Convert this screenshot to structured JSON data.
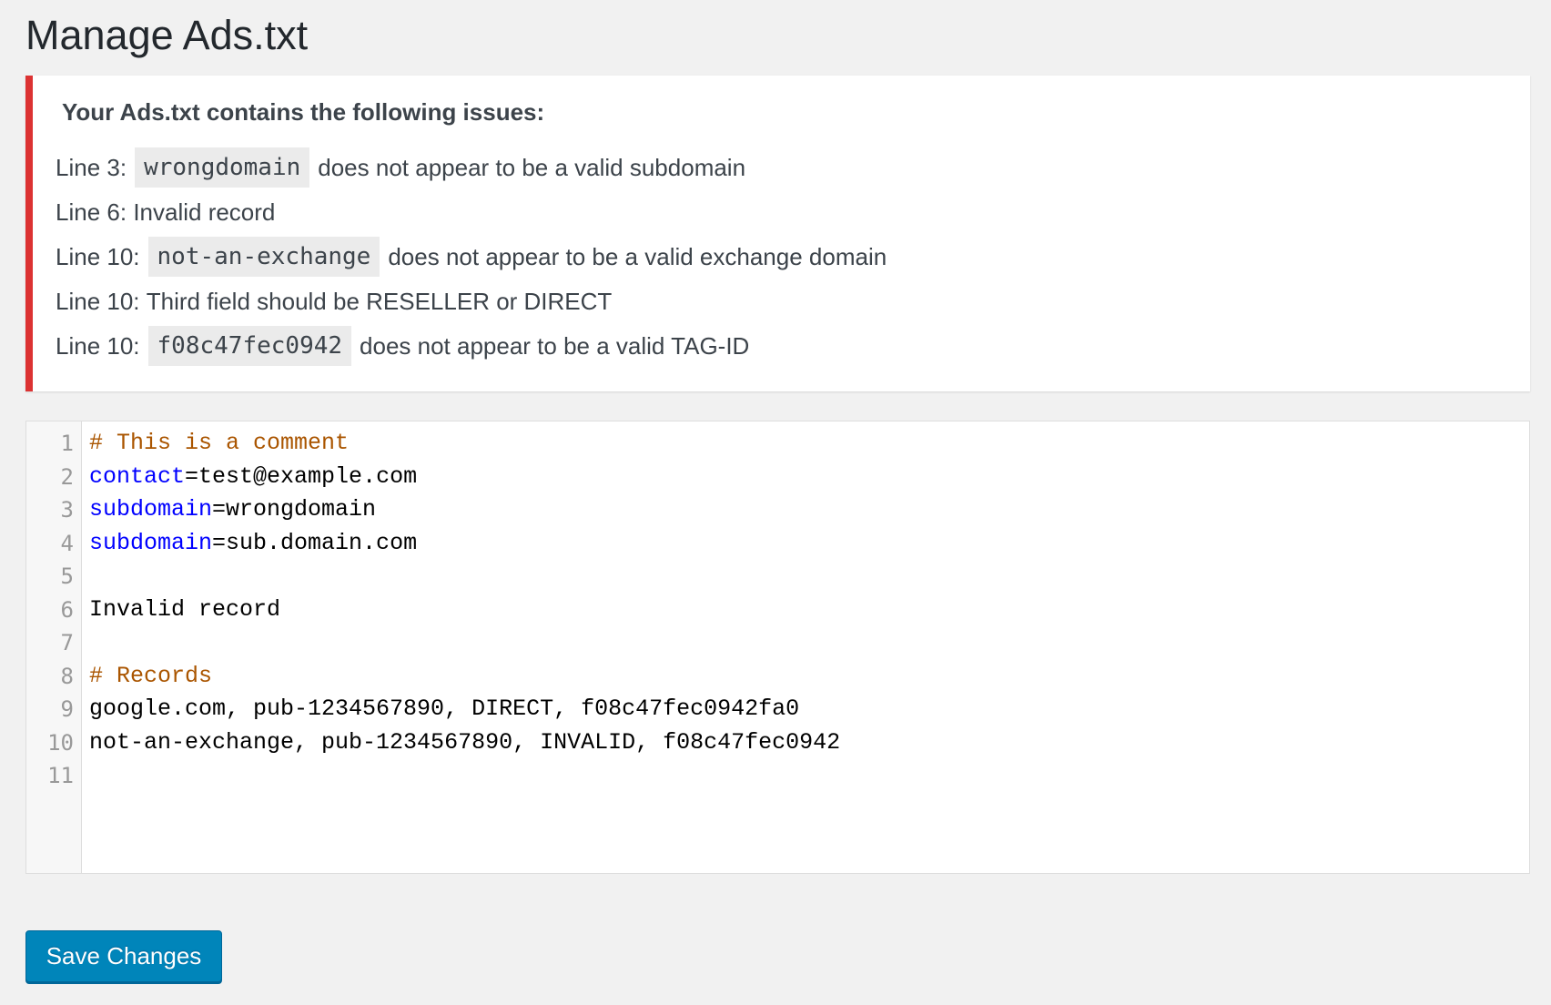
{
  "page": {
    "title": "Manage Ads.txt"
  },
  "notice": {
    "heading": "Your Ads.txt contains the following issues:",
    "border_color": "#dc3232",
    "issues": [
      {
        "prefix": "Line 3:",
        "code": "wrongdomain",
        "message": "does not appear to be a valid subdomain"
      },
      {
        "prefix": "Line 6:",
        "code": "",
        "message": "Invalid record"
      },
      {
        "prefix": "Line 10:",
        "code": "not-an-exchange",
        "message": "does not appear to be a valid exchange domain"
      },
      {
        "prefix": "Line 10:",
        "code": "",
        "message": "Third field should be RESELLER or DIRECT"
      },
      {
        "prefix": "Line 10:",
        "code": "f08c47fec0942",
        "message": "does not appear to be a valid TAG-ID"
      }
    ]
  },
  "editor": {
    "comment_color": "#aa5500",
    "key_color": "#0000ff",
    "lines": [
      {
        "number": "1",
        "tokens": [
          {
            "type": "comment",
            "text": "# This is a comment"
          }
        ]
      },
      {
        "number": "2",
        "tokens": [
          {
            "type": "key",
            "text": "contact"
          },
          {
            "type": "plain",
            "text": "=test@example.com"
          }
        ]
      },
      {
        "number": "3",
        "tokens": [
          {
            "type": "key",
            "text": "subdomain"
          },
          {
            "type": "plain",
            "text": "=wrongdomain"
          }
        ]
      },
      {
        "number": "4",
        "tokens": [
          {
            "type": "key",
            "text": "subdomain"
          },
          {
            "type": "plain",
            "text": "=sub.domain.com"
          }
        ]
      },
      {
        "number": "5",
        "tokens": []
      },
      {
        "number": "6",
        "tokens": [
          {
            "type": "plain",
            "text": "Invalid record"
          }
        ]
      },
      {
        "number": "7",
        "tokens": []
      },
      {
        "number": "8",
        "tokens": [
          {
            "type": "comment",
            "text": "# Records"
          }
        ]
      },
      {
        "number": "9",
        "tokens": [
          {
            "type": "plain",
            "text": "google.com, pub-1234567890, DIRECT, f08c47fec0942fa0"
          }
        ]
      },
      {
        "number": "10",
        "tokens": [
          {
            "type": "plain",
            "text": "not-an-exchange, pub-1234567890, INVALID, f08c47fec0942"
          }
        ]
      },
      {
        "number": "11",
        "tokens": []
      }
    ]
  },
  "actions": {
    "save_label": "Save Changes",
    "save_color": "#0085ba"
  }
}
